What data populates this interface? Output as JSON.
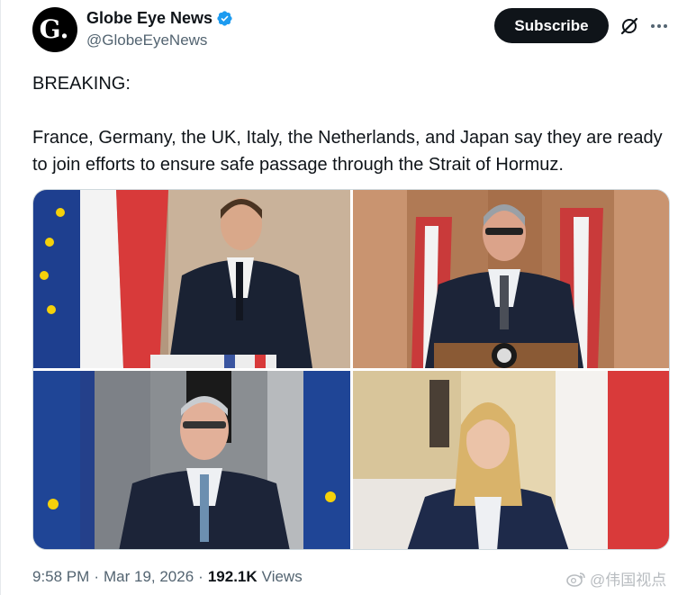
{
  "author": {
    "display_name": "Globe Eye News",
    "handle": "@GlobeEyeNews",
    "avatar_letter": "G."
  },
  "header": {
    "subscribe_label": "Subscribe",
    "grok_icon": "grok-slash-icon",
    "more_icon": "more-dots-icon"
  },
  "tweet": {
    "line1": "BREAKING:",
    "line2": "France, Germany, the UK, Italy, the Netherlands, and Japan say they are ready to join efforts to ensure safe passage through the Strait of Hormuz."
  },
  "media": {
    "photos": [
      "photo-macron",
      "photo-starmer",
      "photo-merz",
      "photo-meloni"
    ]
  },
  "meta": {
    "time": "9:58 PM",
    "sep1": "·",
    "date": "Mar 19, 2026",
    "sep2": "·",
    "views_count": "192.1K",
    "views_label": "Views"
  },
  "watermark": {
    "text": "@伟国视点"
  },
  "colors": {
    "accent": "#1d9bf0",
    "text": "#0f1419",
    "secondary": "#536471",
    "button_bg": "#0f1419"
  }
}
